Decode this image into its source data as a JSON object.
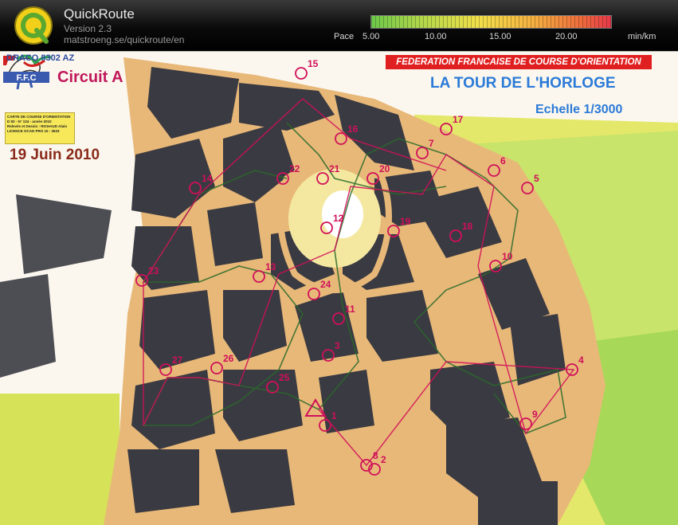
{
  "app": {
    "name": "QuickRoute",
    "version": "Version 2.3",
    "url": "matstroeng.se/quickroute/en"
  },
  "pace_legend": {
    "label": "Pace",
    "ticks": [
      "5.00",
      "10.00",
      "15.00",
      "20.00"
    ],
    "unit": "min/km",
    "colors": [
      "#6cc84a",
      "#b5d84a",
      "#f2e04a",
      "#f5b040",
      "#ee6a3c",
      "#e8384a"
    ]
  },
  "map": {
    "club_code": "DRACO 8302 AZ",
    "circuit": "Circuit A",
    "date": "19 Juin 2010",
    "federation": "FEDERATION FRANCAISE DE COURSE D'ORIENTATION",
    "title": "LA TOUR DE L'HORLOGE",
    "scale": "Echelle 1/3000",
    "info_box": {
      "line1": "CARTE DE COURSE D'ORIENTATION",
      "line2": "D 83 - N° 134 - année 2010",
      "line3": "Relevés et Dessin : RICHAUD Alain",
      "line4": "LICENCE OCAD PRO 10 : 3633"
    },
    "ffc_logo_text": "F.F.C",
    "colors": {
      "building": "#3a3a42",
      "street": "#e8b878",
      "open_land": "#d8e050",
      "forest": "#b8e060",
      "course": "#d0105a",
      "route": "#2a6a2a"
    },
    "controls": [
      {
        "label": "1"
      },
      {
        "label": "2"
      },
      {
        "label": "3"
      },
      {
        "label": "4"
      },
      {
        "label": "5"
      },
      {
        "label": "6"
      },
      {
        "label": "7"
      },
      {
        "label": "8"
      },
      {
        "label": "9"
      },
      {
        "label": "10"
      },
      {
        "label": "11"
      },
      {
        "label": "12"
      },
      {
        "label": "13"
      },
      {
        "label": "14"
      },
      {
        "label": "15"
      },
      {
        "label": "16"
      },
      {
        "label": "17"
      },
      {
        "label": "18"
      },
      {
        "label": "19"
      },
      {
        "label": "20"
      },
      {
        "label": "21"
      },
      {
        "label": "22"
      },
      {
        "label": "23"
      },
      {
        "label": "24"
      },
      {
        "label": "25"
      },
      {
        "label": "26"
      },
      {
        "label": "27"
      }
    ]
  }
}
